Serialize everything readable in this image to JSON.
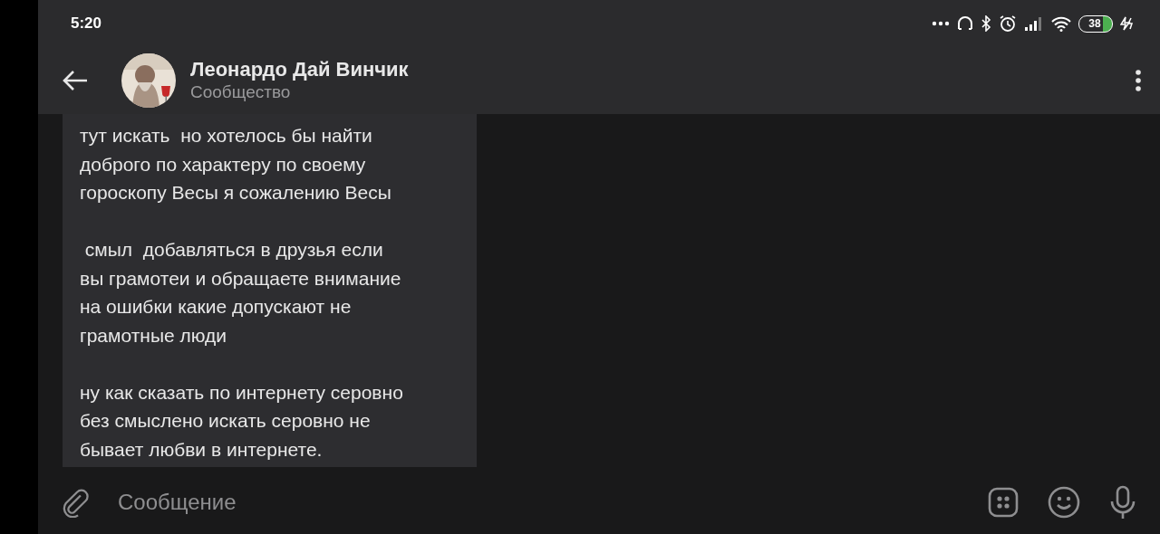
{
  "status_bar": {
    "time": "5:20",
    "battery": "38"
  },
  "header": {
    "title": "Леонардо Дай Винчик",
    "subtitle": "Сообщество"
  },
  "message": {
    "paragraphs": [
      [
        "тут искать  но хотелось бы найти",
        "доброго по характеру по своему",
        "гороскопу Весы я сожалению Весы"
      ],
      [
        " смыл  добавляться в друзья если",
        "вы грамотеи и обращаете внимание",
        "на ошибки какие допускают не",
        "грамотные люди"
      ],
      [
        "ну как сказать по интернету серовно",
        "без смыслено искать серовно не",
        "бывает любви в интернете."
      ]
    ]
  },
  "composer": {
    "placeholder": "Сообщение"
  }
}
